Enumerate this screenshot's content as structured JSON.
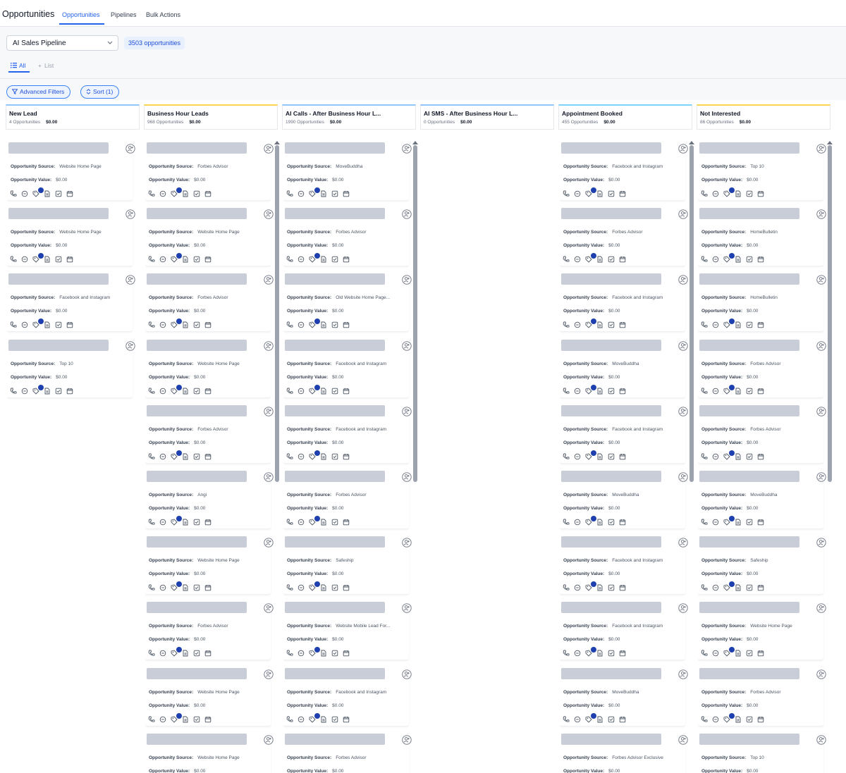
{
  "app": {
    "title": "Opportunities"
  },
  "nav": {
    "tabs": [
      "Opportunities",
      "Pipelines",
      "Bulk Actions"
    ]
  },
  "toolbar": {
    "pipeline": "AI Sales Pipeline",
    "count": "3503 opportunities",
    "view_all": "All",
    "view_list": "List",
    "advanced_filters": "Advanced Filters",
    "sort": "Sort (1)"
  },
  "labels": {
    "source": "Opportunity Source:",
    "value": "Opportunity Value:"
  },
  "columns": [
    {
      "name": "New Lead",
      "count": "4 Opportunities",
      "total": "$0.00",
      "cards": [
        {
          "source": "Website Home Page",
          "value": "$0.00"
        },
        {
          "source": "Website Home Page",
          "value": "$0.00"
        },
        {
          "source": "Facebook and Instagram",
          "value": "$0.00"
        },
        {
          "source": "Top 10",
          "value": "$0.00"
        }
      ]
    },
    {
      "name": "Business Hour Leads",
      "count": "968 Opportunities",
      "total": "$0.00",
      "cards": [
        {
          "source": "Forbes Advisor",
          "value": "$0.00"
        },
        {
          "source": "Website Home Page",
          "value": "$0.00"
        },
        {
          "source": "Forbes Advisor",
          "value": "$0.00"
        },
        {
          "source": "Website Home Page",
          "value": "$0.00"
        },
        {
          "source": "Forbes Advisor",
          "value": "$0.00"
        },
        {
          "source": "Angi",
          "value": "$0.00"
        },
        {
          "source": "Website Home Page",
          "value": "$0.00"
        },
        {
          "source": "Forbes Advisor",
          "value": "$0.00"
        },
        {
          "source": "Website Home Page",
          "value": "$0.00"
        },
        {
          "source": "Website Home Page",
          "value": "$0.00"
        }
      ]
    },
    {
      "name": "AI Calls - After Business Hour L...",
      "count": "1990 Opportunities",
      "total": "$0.00",
      "cards": [
        {
          "source": "MoveBuddha",
          "value": "$0.00"
        },
        {
          "source": "Forbes Advisor",
          "value": "$0.00"
        },
        {
          "source": "Old Website Home Page...",
          "value": "$0.00"
        },
        {
          "source": "Facebook and Instagram",
          "value": "$0.00"
        },
        {
          "source": "Facebook and Instagram",
          "value": "$0.00"
        },
        {
          "source": "Forbes Advisor",
          "value": "$0.00"
        },
        {
          "source": "Safeship",
          "value": "$0.00"
        },
        {
          "source": "Website Mobile Lead For...",
          "value": "$0.00"
        },
        {
          "source": "Facebook and Instagram",
          "value": "$0.00"
        },
        {
          "source": "Forbes Advisor",
          "value": "$0.00"
        }
      ]
    },
    {
      "name": "AI SMS - After Business Hour L...",
      "count": "0 Opportunities",
      "total": "$0.00",
      "cards": []
    },
    {
      "name": "Appointment Booked",
      "count": "455 Opportunities",
      "total": "$0.00",
      "cards": [
        {
          "source": "Facebook and Instagram",
          "value": "$0.00"
        },
        {
          "source": "Forbes Advisor",
          "value": "$0.00"
        },
        {
          "source": "Facebook and Instagram",
          "value": "$0.00"
        },
        {
          "source": "MoveBuddha",
          "value": "$0.00"
        },
        {
          "source": "Facebook and Instagram",
          "value": "$0.00"
        },
        {
          "source": "MoveBuddha",
          "value": "$0.00"
        },
        {
          "source": "Facebook and Instagram",
          "value": "$0.00"
        },
        {
          "source": "Facebook and Instagram",
          "value": "$0.00"
        },
        {
          "source": "MoveBuddha",
          "value": "$0.00"
        },
        {
          "source": "Forbes Advisor Exclusive",
          "value": "$0.00"
        }
      ]
    },
    {
      "name": "Not Interested",
      "count": "86 Opportunities",
      "total": "$0.00",
      "cards": [
        {
          "source": "Top 10",
          "value": "$0.00"
        },
        {
          "source": "HomeBulletin",
          "value": "$0.00"
        },
        {
          "source": "HomeBulletin",
          "value": "$0.00"
        },
        {
          "source": "Forbes Advisor",
          "value": "$0.00"
        },
        {
          "source": "Forbes Advisor",
          "value": "$0.00"
        },
        {
          "source": "MoveBuddha",
          "value": "$0.00"
        },
        {
          "source": "Safeship",
          "value": "$0.00"
        },
        {
          "source": "Website Home Page",
          "value": "$0.00"
        },
        {
          "source": "Forbes Advisor",
          "value": "$0.00"
        },
        {
          "source": "Top 10",
          "value": "$0.00"
        }
      ]
    }
  ],
  "colors": {
    "accent": "#2563eb",
    "placeholder": "#c8cdd8",
    "badge": "#1e40af"
  }
}
